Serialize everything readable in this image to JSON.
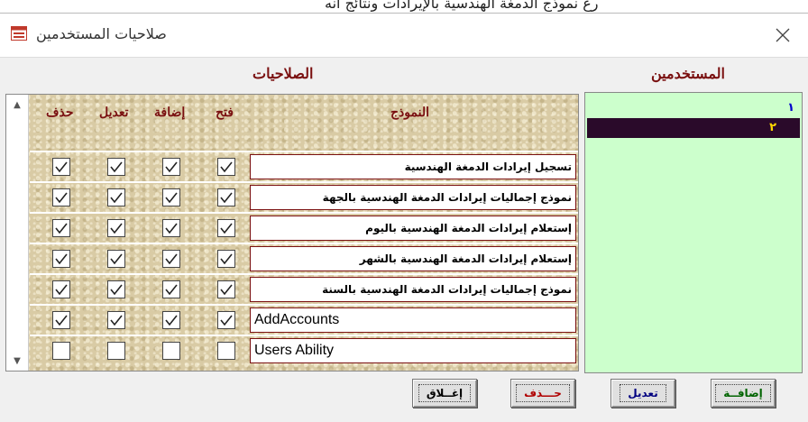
{
  "background_text": "رع  نموذج الدمغة الهندسية بالإيرادات ونتائج أنه",
  "window": {
    "title": "صلاحيات المستخدمين"
  },
  "headings": {
    "permissions": "الصلاحيات",
    "users": "المستخدمين"
  },
  "columns": {
    "form": "النموذج",
    "open": "فتح",
    "add": "إضافة",
    "edit": "تعديل",
    "delete": "حذف"
  },
  "rows": [
    {
      "name": "تسجيل  إيرادات الدمغة الهندسية",
      "open": true,
      "add": true,
      "edit": true,
      "delete": true
    },
    {
      "name": "نموذج إجماليات إيرادات الدمغة الهندسية بالجهة",
      "open": true,
      "add": true,
      "edit": true,
      "delete": true
    },
    {
      "name": "إستعلام إيرادات الدمغة الهندسية باليوم",
      "open": true,
      "add": true,
      "edit": true,
      "delete": true
    },
    {
      "name": "إستعلام إيرادات الدمغة الهندسية بالشهر",
      "open": true,
      "add": true,
      "edit": true,
      "delete": true
    },
    {
      "name": "نموذج إجماليات إيرادات الدمغة الهندسية بالسنة",
      "open": true,
      "add": true,
      "edit": true,
      "delete": true
    },
    {
      "name": "AddAccounts",
      "open": true,
      "add": true,
      "edit": true,
      "delete": true
    },
    {
      "name": "Users Ability",
      "open": false,
      "add": false,
      "edit": false,
      "delete": false
    }
  ],
  "users": [
    {
      "label": "١",
      "selected": false
    },
    {
      "label": "٢",
      "selected": true
    }
  ],
  "buttons": {
    "add": "إضافــة",
    "edit": "تعديل",
    "delete": "حـــذف",
    "close": "إغــلاق"
  },
  "icons": {
    "window": "form-icon",
    "close": "close-icon",
    "scroll_up": "scroll-up-arrow-icon",
    "scroll_down": "scroll-down-arrow-icon",
    "checkbox": "checkmark-icon"
  },
  "colors": {
    "heading": "#7a1010",
    "users_bg": "#ccffcc",
    "selected_user": "#2a0a2a",
    "selected_user_text": "#ffd700"
  }
}
